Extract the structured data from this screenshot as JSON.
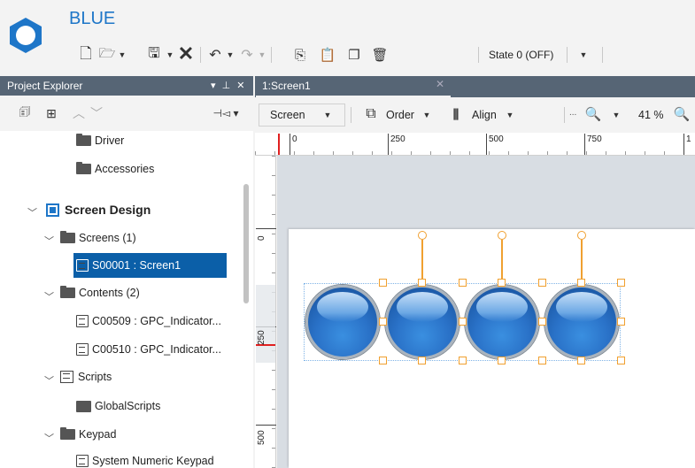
{
  "app": {
    "title": "BLUE",
    "state_label": "State 0 (OFF)"
  },
  "explorer": {
    "title": "Project Explorer",
    "pin": "▾ ⊥ ✕"
  },
  "tree": {
    "driver": "Driver",
    "accessories": "Accessories",
    "screen_design": "Screen Design",
    "screens": "Screens (1)",
    "screen1": "S00001 : Screen1",
    "contents": "Contents (2)",
    "c1": "C00509 : GPC_Indicator...",
    "c2": "C00510 : GPC_Indicator...",
    "scripts": "Scripts",
    "global_scripts": "GlobalScripts",
    "keypad": "Keypad",
    "numeric_keypad": "System Numeric Keypad"
  },
  "editor": {
    "tab_label": "1:Screen1",
    "screen_label": "Screen",
    "order_label": "Order",
    "align_label": "Align",
    "zoom_label": "41 %",
    "more": "..."
  },
  "ruler": {
    "h": [
      "0",
      "250",
      "500",
      "750",
      "1"
    ],
    "v": [
      "0",
      "250",
      "500"
    ]
  },
  "colors": {
    "accent": "#0b5fa8",
    "title_blue": "#1e76c8",
    "orange_handle": "#f0a030"
  }
}
